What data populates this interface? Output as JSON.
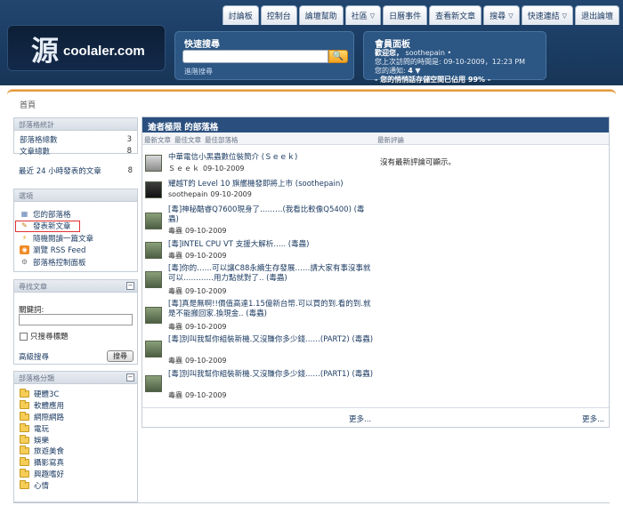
{
  "header": {
    "logo_glyph": "源",
    "site_name": "coolaler.com",
    "nav": [
      "討論板",
      "控制台",
      "論壇幫助",
      "社區",
      "日曆事件",
      "查看新文章",
      "搜尋",
      "快速連結",
      "退出論壇"
    ],
    "nav_caret": "▽"
  },
  "search": {
    "title": "快速搜尋",
    "button": "🔍",
    "advanced": "進階搜尋"
  },
  "member": {
    "title": "會員面板",
    "welcome": "歡迎您，",
    "username": "soothepain",
    "last_visit_label": "您上次訪問的時間是:",
    "last_visit": "09-10-2009，12:23 PM",
    "notifications_label": "您的通知:",
    "notifications_count": "4",
    "mailbox": "- 您的悄悄話存儲空間已佔用 99% -"
  },
  "breadcrumb": {
    "home": "首頁"
  },
  "sidebar": {
    "stats": {
      "title": "部落格統計",
      "rows": [
        {
          "label": "部落格總數",
          "value": "3"
        },
        {
          "label": "文章總數",
          "value": "8"
        },
        {
          "label": "最近 24 小時發表的文章",
          "value": "8"
        }
      ]
    },
    "options": {
      "title": "選項",
      "items": [
        "您的部落格",
        "發表新文章",
        "隨機閱讀一篇文章",
        "瀏覽 RSS Feed",
        "部落格控制面板"
      ]
    },
    "search": {
      "title": "尋找文章",
      "keyword_label": "關鍵詞:",
      "title_only": "只搜尋標題",
      "advanced": "高級搜尋",
      "button": "搜尋"
    },
    "categories": {
      "title": "部落格分類",
      "items": [
        "硬體3C",
        "軟體應用",
        "網際網路",
        "電玩",
        "娛樂",
        "旅遊美食",
        "攝影寫真",
        "興趣嗜好",
        "心情"
      ]
    }
  },
  "main": {
    "title": "逾者極限 的部落格",
    "col_recent": "最新文章",
    "col_best": "最佳文章",
    "col_bestblog": "最佳部落格",
    "col_comments": "最新評論",
    "no_comments": "沒有最新評論可顯示。",
    "more": "更多...",
    "posts": [
      {
        "title": "中華電信小黑蟲數位裝簡介 (Ｓｅｅｋ)",
        "author": "Ｓｅｅｋ",
        "date": "09-10-2009"
      },
      {
        "title": "耀越T的 Level 10 旗艦機發即將上市 (soothepain)",
        "author": "soothepain",
        "date": "09-10-2009"
      },
      {
        "title": "[毒]神秘酷睿Q7600現身了………(我看比較像Q5400) (毒蟲)",
        "author": "毒蟲",
        "date": "09-10-2009"
      },
      {
        "title": "[毒]INTEL CPU VT 支援大解析….. (毒蟲)",
        "author": "毒蟲",
        "date": "09-10-2009"
      },
      {
        "title": "[毒]你的……可以讓C88永續生存發展……請大家有事沒事就可以…………用力點就對了.. (毒蟲)",
        "author": "毒蟲",
        "date": "09-10-2009"
      },
      {
        "title": "[毒]真是無啊!!價值高達1.15億新台幣.可以買的到.看的到.就是不能搬回家.換現金.. (毒蟲)",
        "author": "毒蟲",
        "date": "09-10-2009"
      },
      {
        "title": "[毒]別叫我幫你組裝新機.又沒賺你多少錢……(PART2) (毒蟲)",
        "author": "毒蟲",
        "date": "09-10-2009"
      },
      {
        "title": "[毒]別叫我幫你組裝新機.又沒賺你多少錢……(PART1) (毒蟲)",
        "author": "毒蟲",
        "date": "09-10-2009"
      }
    ]
  },
  "colors": {
    "header_bg": "#1a3b62",
    "panel_bg": "#2c5683",
    "main_head": "#2a4f7f",
    "accent_orange": "#e39a3a",
    "link": "#1d3c63"
  }
}
